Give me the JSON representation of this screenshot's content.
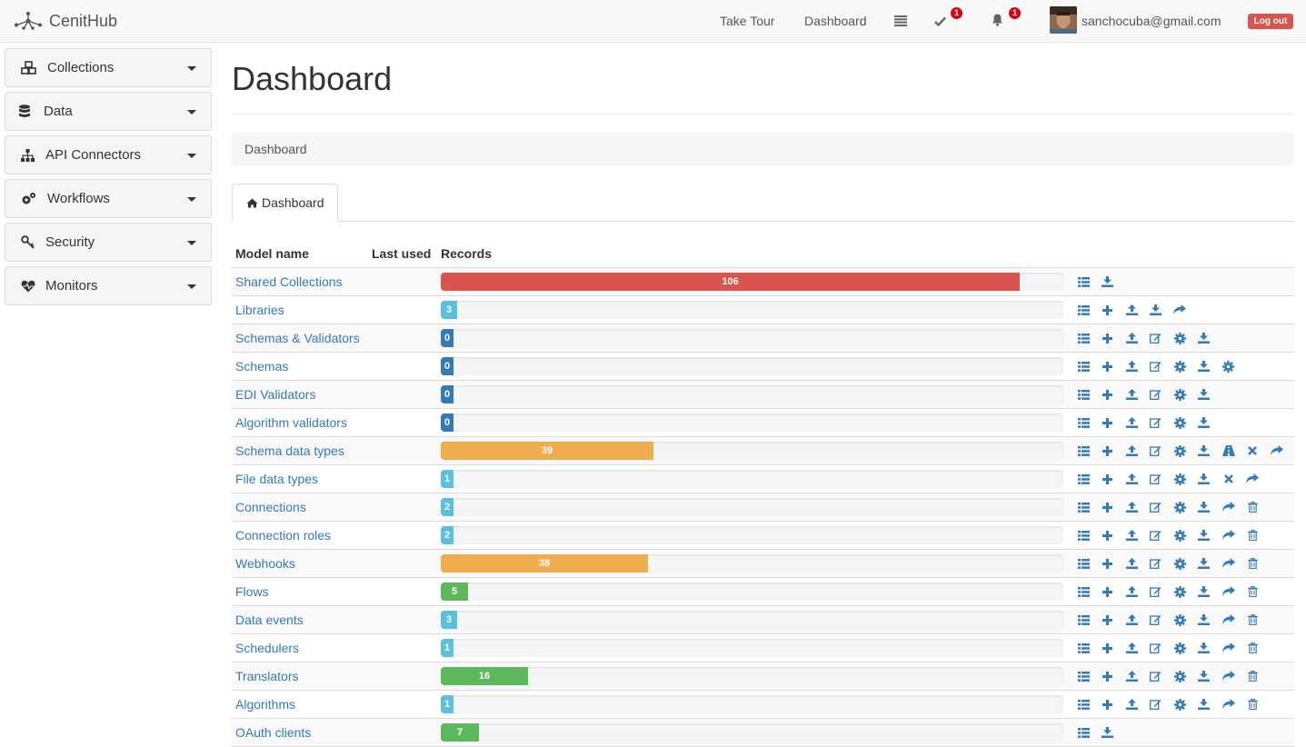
{
  "brand": {
    "name": "CenitHub"
  },
  "navbar": {
    "take_tour": "Take Tour",
    "dashboard": "Dashboard",
    "tasks_badge": "1",
    "notifications_badge": "1",
    "user_email": "sanchocuba@gmail.com",
    "logout": "Log out"
  },
  "sidebar": {
    "items": [
      {
        "label": "Collections",
        "icon": "cubes-icon"
      },
      {
        "label": "Data",
        "icon": "database-icon"
      },
      {
        "label": "API Connectors",
        "icon": "sitemap-icon"
      },
      {
        "label": "Workflows",
        "icon": "cogs-icon"
      },
      {
        "label": "Security",
        "icon": "key-icon"
      },
      {
        "label": "Monitors",
        "icon": "heartbeat-icon"
      }
    ]
  },
  "main": {
    "title": "Dashboard",
    "breadcrumb": "Dashboard",
    "tab_label": "Dashboard"
  },
  "table": {
    "headers": {
      "model_name": "Model name",
      "last_used": "Last used",
      "records": "Records"
    },
    "max_records": 114,
    "rows": [
      {
        "name": "Shared Collections",
        "records": "106",
        "value": 106,
        "color": "#d9534f",
        "actions": [
          "list",
          "download"
        ]
      },
      {
        "name": "Libraries",
        "records": "3",
        "value": 3,
        "color": "#5bc0de",
        "actions": [
          "list",
          "plus",
          "upload",
          "download",
          "share"
        ]
      },
      {
        "name": "Schemas & Validators",
        "records": "0",
        "value": 0,
        "color": "#337ab7",
        "actions": [
          "list",
          "plus",
          "upload",
          "edit",
          "cog",
          "download"
        ]
      },
      {
        "name": "Schemas",
        "records": "0",
        "value": 0,
        "color": "#337ab7",
        "actions": [
          "list",
          "plus",
          "upload",
          "edit",
          "cog",
          "download",
          "cog"
        ]
      },
      {
        "name": "EDI Validators",
        "records": "0",
        "value": 0,
        "color": "#337ab7",
        "actions": [
          "list",
          "plus",
          "upload",
          "edit",
          "cog",
          "download"
        ]
      },
      {
        "name": "Algorithm validators",
        "records": "0",
        "value": 0,
        "color": "#337ab7",
        "actions": [
          "list",
          "plus",
          "upload",
          "edit",
          "cog",
          "download"
        ]
      },
      {
        "name": "Schema data types",
        "records": "39",
        "value": 39,
        "color": "#f0ad4e",
        "actions": [
          "list",
          "plus",
          "upload",
          "edit",
          "cog",
          "download",
          "road",
          "remove",
          "share"
        ]
      },
      {
        "name": "File data types",
        "records": "1",
        "value": 1,
        "color": "#5bc0de",
        "actions": [
          "list",
          "plus",
          "upload",
          "edit",
          "cog",
          "download",
          "remove",
          "share"
        ]
      },
      {
        "name": "Connections",
        "records": "2",
        "value": 2,
        "color": "#5bc0de",
        "actions": [
          "list",
          "plus",
          "upload",
          "edit",
          "cog",
          "download",
          "share",
          "trash"
        ]
      },
      {
        "name": "Connection roles",
        "records": "2",
        "value": 2,
        "color": "#5bc0de",
        "actions": [
          "list",
          "plus",
          "upload",
          "edit",
          "cog",
          "download",
          "share",
          "trash"
        ]
      },
      {
        "name": "Webhooks",
        "records": "38",
        "value": 38,
        "color": "#f0ad4e",
        "actions": [
          "list",
          "plus",
          "upload",
          "edit",
          "cog",
          "download",
          "share",
          "trash"
        ]
      },
      {
        "name": "Flows",
        "records": "5",
        "value": 5,
        "color": "#5cb85c",
        "actions": [
          "list",
          "plus",
          "upload",
          "edit",
          "cog",
          "download",
          "share",
          "trash"
        ]
      },
      {
        "name": "Data events",
        "records": "3",
        "value": 3,
        "color": "#5bc0de",
        "actions": [
          "list",
          "plus",
          "upload",
          "edit",
          "cog",
          "download",
          "share",
          "trash"
        ]
      },
      {
        "name": "Schedulers",
        "records": "1",
        "value": 1,
        "color": "#5bc0de",
        "actions": [
          "list",
          "plus",
          "upload",
          "edit",
          "cog",
          "download",
          "share",
          "trash"
        ]
      },
      {
        "name": "Translators",
        "records": "16",
        "value": 16,
        "color": "#5cb85c",
        "actions": [
          "list",
          "plus",
          "upload",
          "edit",
          "cog",
          "download",
          "share",
          "trash"
        ]
      },
      {
        "name": "Algorithms",
        "records": "1",
        "value": 1,
        "color": "#5bc0de",
        "actions": [
          "list",
          "plus",
          "upload",
          "edit",
          "cog",
          "download",
          "share",
          "trash"
        ]
      },
      {
        "name": "OAuth clients",
        "records": "7",
        "value": 7,
        "color": "#5cb85c",
        "actions": [
          "list",
          "download"
        ]
      }
    ]
  }
}
